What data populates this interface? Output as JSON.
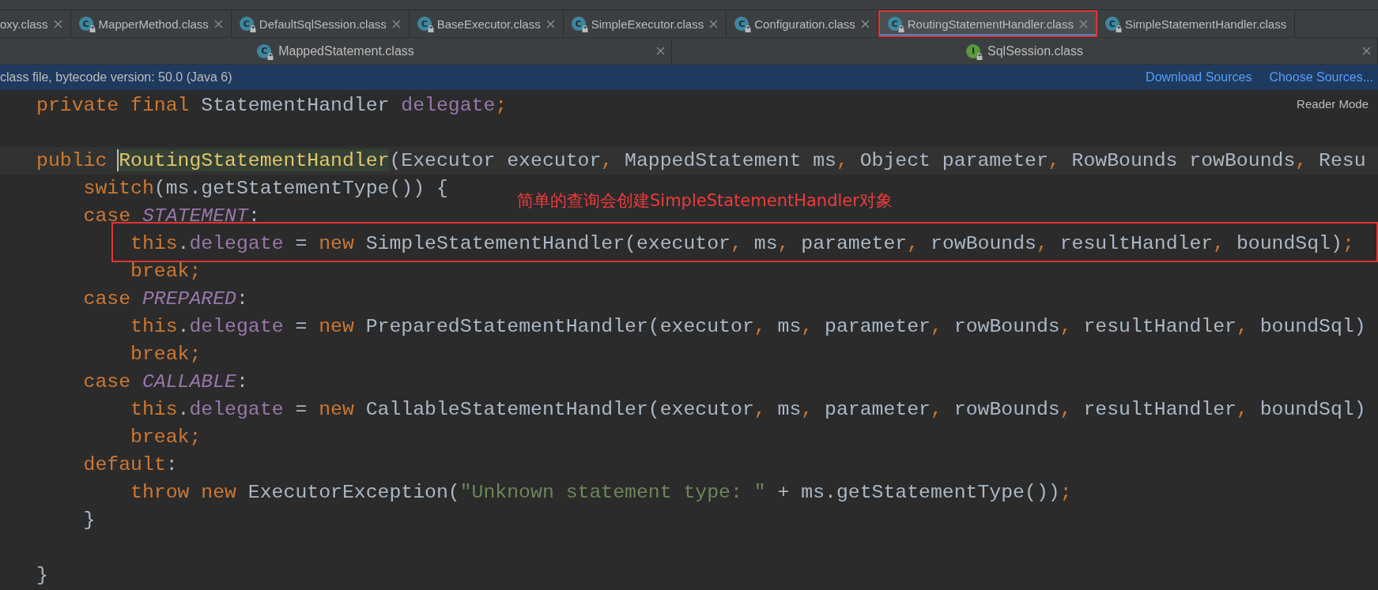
{
  "tab_bar": {
    "tabs": [
      {
        "label": "oxy.class",
        "selected": false,
        "annotated": false,
        "closable": true
      },
      {
        "label": "MapperMethod.class",
        "badge": "C",
        "kind": "class",
        "selected": false,
        "annotated": false,
        "closable": true
      },
      {
        "label": "DefaultSqlSession.class",
        "badge": "C",
        "kind": "class",
        "selected": false,
        "annotated": false,
        "closable": true
      },
      {
        "label": "BaseExecutor.class",
        "badge": "C",
        "kind": "class",
        "selected": false,
        "annotated": false,
        "closable": true
      },
      {
        "label": "SimpleExecutor.class",
        "badge": "C",
        "kind": "class",
        "selected": false,
        "annotated": false,
        "closable": true
      },
      {
        "label": "Configuration.class",
        "badge": "C",
        "kind": "class",
        "selected": false,
        "annotated": false,
        "closable": true
      },
      {
        "label": "RoutingStatementHandler.class",
        "badge": "C",
        "kind": "class",
        "selected": true,
        "annotated": true,
        "closable": true
      },
      {
        "label": "SimpleStatementHandler.class",
        "badge": "C",
        "kind": "class",
        "selected": false,
        "annotated": false,
        "closable": false
      }
    ]
  },
  "split_tabs": [
    {
      "label": "MappedStatement.class",
      "badge": "C",
      "kind": "class"
    },
    {
      "label": "SqlSession.class",
      "badge": "I",
      "kind": "interface"
    }
  ],
  "info_bar": {
    "message": "class file, bytecode version: 50.0 (Java 6)",
    "links": [
      "Download Sources",
      "Choose Sources..."
    ]
  },
  "editor": {
    "reader_mode": "Reader Mode",
    "annotation": "简单的查询会创建SimpleStatementHandler对象",
    "lines": [
      {
        "kind": "code",
        "current": false,
        "annotated": false,
        "tokens": [
          {
            "text": "private final ",
            "kind": "keyword"
          },
          {
            "text": "StatementHandler ",
            "kind": "plain"
          },
          {
            "text": "delegate",
            "kind": "field"
          },
          {
            "text": ";",
            "kind": "keyword"
          }
        ]
      },
      {
        "kind": "blank"
      },
      {
        "kind": "code",
        "current": true,
        "annotated": false,
        "tokens": [
          {
            "text": "public ",
            "kind": "keyword"
          },
          {
            "text": "RoutingStatementHandler",
            "kind": "declaration"
          },
          {
            "text": "(Executor executor",
            "kind": "plain"
          },
          {
            "text": ", ",
            "kind": "keyword"
          },
          {
            "text": "MappedStatement ms",
            "kind": "plain"
          },
          {
            "text": ", ",
            "kind": "keyword"
          },
          {
            "text": "Object parameter",
            "kind": "plain"
          },
          {
            "text": ", ",
            "kind": "keyword"
          },
          {
            "text": "RowBounds rowBounds",
            "kind": "plain"
          },
          {
            "text": ", ",
            "kind": "keyword"
          },
          {
            "text": "Resu",
            "kind": "plain"
          }
        ]
      },
      {
        "kind": "code",
        "current": false,
        "annotated": false,
        "tokens": [
          {
            "text": "    switch",
            "kind": "keyword"
          },
          {
            "text": "(ms.getStatementType()) {",
            "kind": "plain"
          }
        ]
      },
      {
        "kind": "code",
        "current": false,
        "annotated": false,
        "tokens": [
          {
            "text": "    case ",
            "kind": "keyword"
          },
          {
            "text": "STATEMENT",
            "kind": "constant"
          },
          {
            "text": ":",
            "kind": "plain"
          }
        ]
      },
      {
        "kind": "code",
        "current": false,
        "annotated": true,
        "tokens": [
          {
            "text": "        this",
            "kind": "keyword"
          },
          {
            "text": ".",
            "kind": "plain"
          },
          {
            "text": "delegate",
            "kind": "field"
          },
          {
            "text": " = ",
            "kind": "plain"
          },
          {
            "text": "new ",
            "kind": "keyword"
          },
          {
            "text": "SimpleStatementHandler(executor",
            "kind": "plain"
          },
          {
            "text": ", ",
            "kind": "keyword"
          },
          {
            "text": "ms",
            "kind": "plain"
          },
          {
            "text": ", ",
            "kind": "keyword"
          },
          {
            "text": "parameter",
            "kind": "plain"
          },
          {
            "text": ", ",
            "kind": "keyword"
          },
          {
            "text": "rowBounds",
            "kind": "plain"
          },
          {
            "text": ", ",
            "kind": "keyword"
          },
          {
            "text": "resultHandler",
            "kind": "plain"
          },
          {
            "text": ", ",
            "kind": "keyword"
          },
          {
            "text": "boundSql)",
            "kind": "plain"
          },
          {
            "text": ";",
            "kind": "keyword"
          }
        ]
      },
      {
        "kind": "code",
        "current": false,
        "annotated": false,
        "tokens": [
          {
            "text": "        break;",
            "kind": "keyword"
          }
        ]
      },
      {
        "kind": "code",
        "current": false,
        "annotated": false,
        "tokens": [
          {
            "text": "    case ",
            "kind": "keyword"
          },
          {
            "text": "PREPARED",
            "kind": "constant"
          },
          {
            "text": ":",
            "kind": "plain"
          }
        ]
      },
      {
        "kind": "code",
        "current": false,
        "annotated": false,
        "tokens": [
          {
            "text": "        this",
            "kind": "keyword"
          },
          {
            "text": ".",
            "kind": "plain"
          },
          {
            "text": "delegate",
            "kind": "field"
          },
          {
            "text": " = ",
            "kind": "plain"
          },
          {
            "text": "new ",
            "kind": "keyword"
          },
          {
            "text": "PreparedStatementHandler(executor",
            "kind": "plain"
          },
          {
            "text": ", ",
            "kind": "keyword"
          },
          {
            "text": "ms",
            "kind": "plain"
          },
          {
            "text": ", ",
            "kind": "keyword"
          },
          {
            "text": "parameter",
            "kind": "plain"
          },
          {
            "text": ", ",
            "kind": "keyword"
          },
          {
            "text": "rowBounds",
            "kind": "plain"
          },
          {
            "text": ", ",
            "kind": "keyword"
          },
          {
            "text": "resultHandler",
            "kind": "plain"
          },
          {
            "text": ", ",
            "kind": "keyword"
          },
          {
            "text": "boundSql)",
            "kind": "plain"
          }
        ]
      },
      {
        "kind": "code",
        "current": false,
        "annotated": false,
        "tokens": [
          {
            "text": "        break;",
            "kind": "keyword"
          }
        ]
      },
      {
        "kind": "code",
        "current": false,
        "annotated": false,
        "tokens": [
          {
            "text": "    case ",
            "kind": "keyword"
          },
          {
            "text": "CALLABLE",
            "kind": "constant"
          },
          {
            "text": ":",
            "kind": "plain"
          }
        ]
      },
      {
        "kind": "code",
        "current": false,
        "annotated": false,
        "tokens": [
          {
            "text": "        this",
            "kind": "keyword"
          },
          {
            "text": ".",
            "kind": "plain"
          },
          {
            "text": "delegate",
            "kind": "field"
          },
          {
            "text": " = ",
            "kind": "plain"
          },
          {
            "text": "new ",
            "kind": "keyword"
          },
          {
            "text": "CallableStatementHandler(executor",
            "kind": "plain"
          },
          {
            "text": ", ",
            "kind": "keyword"
          },
          {
            "text": "ms",
            "kind": "plain"
          },
          {
            "text": ", ",
            "kind": "keyword"
          },
          {
            "text": "parameter",
            "kind": "plain"
          },
          {
            "text": ", ",
            "kind": "keyword"
          },
          {
            "text": "rowBounds",
            "kind": "plain"
          },
          {
            "text": ", ",
            "kind": "keyword"
          },
          {
            "text": "resultHandler",
            "kind": "plain"
          },
          {
            "text": ", ",
            "kind": "keyword"
          },
          {
            "text": "boundSql)",
            "kind": "plain"
          }
        ]
      },
      {
        "kind": "code",
        "current": false,
        "annotated": false,
        "tokens": [
          {
            "text": "        break;",
            "kind": "keyword"
          }
        ]
      },
      {
        "kind": "code",
        "current": false,
        "annotated": false,
        "tokens": [
          {
            "text": "    default",
            "kind": "keyword"
          },
          {
            "text": ":",
            "kind": "plain"
          }
        ]
      },
      {
        "kind": "code",
        "current": false,
        "annotated": false,
        "tokens": [
          {
            "text": "        throw new ",
            "kind": "keyword"
          },
          {
            "text": "ExecutorException(",
            "kind": "plain"
          },
          {
            "text": "\"Unknown statement type: \"",
            "kind": "string"
          },
          {
            "text": " + ms.getStatementType())",
            "kind": "plain"
          },
          {
            "text": ";",
            "kind": "keyword"
          }
        ]
      },
      {
        "kind": "code",
        "current": false,
        "annotated": false,
        "tokens": [
          {
            "text": "    }",
            "kind": "plain"
          }
        ]
      },
      {
        "kind": "blank"
      },
      {
        "kind": "code",
        "current": false,
        "annotated": false,
        "tokens": [
          {
            "text": "}",
            "kind": "plain"
          }
        ]
      }
    ]
  }
}
